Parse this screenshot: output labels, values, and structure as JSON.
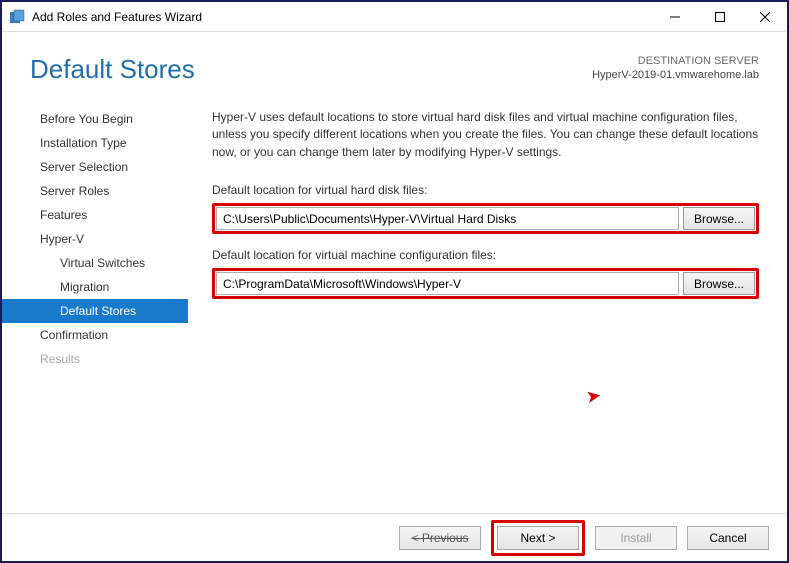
{
  "window": {
    "title": "Add Roles and Features Wizard"
  },
  "header": {
    "page_title": "Default Stores",
    "dest_label": "DESTINATION SERVER",
    "dest_value": "HyperV-2019-01.vmwarehome.lab"
  },
  "nav": {
    "items": [
      {
        "label": "Before You Begin",
        "sub": false,
        "active": false,
        "disabled": false
      },
      {
        "label": "Installation Type",
        "sub": false,
        "active": false,
        "disabled": false
      },
      {
        "label": "Server Selection",
        "sub": false,
        "active": false,
        "disabled": false
      },
      {
        "label": "Server Roles",
        "sub": false,
        "active": false,
        "disabled": false
      },
      {
        "label": "Features",
        "sub": false,
        "active": false,
        "disabled": false
      },
      {
        "label": "Hyper-V",
        "sub": false,
        "active": false,
        "disabled": false
      },
      {
        "label": "Virtual Switches",
        "sub": true,
        "active": false,
        "disabled": false
      },
      {
        "label": "Migration",
        "sub": true,
        "active": false,
        "disabled": false
      },
      {
        "label": "Default Stores",
        "sub": true,
        "active": true,
        "disabled": false
      },
      {
        "label": "Confirmation",
        "sub": false,
        "active": false,
        "disabled": false
      },
      {
        "label": "Results",
        "sub": false,
        "active": false,
        "disabled": true
      }
    ]
  },
  "content": {
    "intro": "Hyper-V uses default locations to store virtual hard disk files and virtual machine configuration files, unless you specify different locations when you create the files. You can change these default locations now, or you can change them later by modifying Hyper-V settings.",
    "vhd_label": "Default location for virtual hard disk files:",
    "vhd_path": "C:\\Users\\Public\\Documents\\Hyper-V\\Virtual Hard Disks",
    "vm_label": "Default location for virtual machine configuration files:",
    "vm_path": "C:\\ProgramData\\Microsoft\\Windows\\Hyper-V",
    "browse": "Browse..."
  },
  "footer": {
    "previous": "< Previous",
    "next": "Next >",
    "install": "Install",
    "cancel": "Cancel"
  }
}
